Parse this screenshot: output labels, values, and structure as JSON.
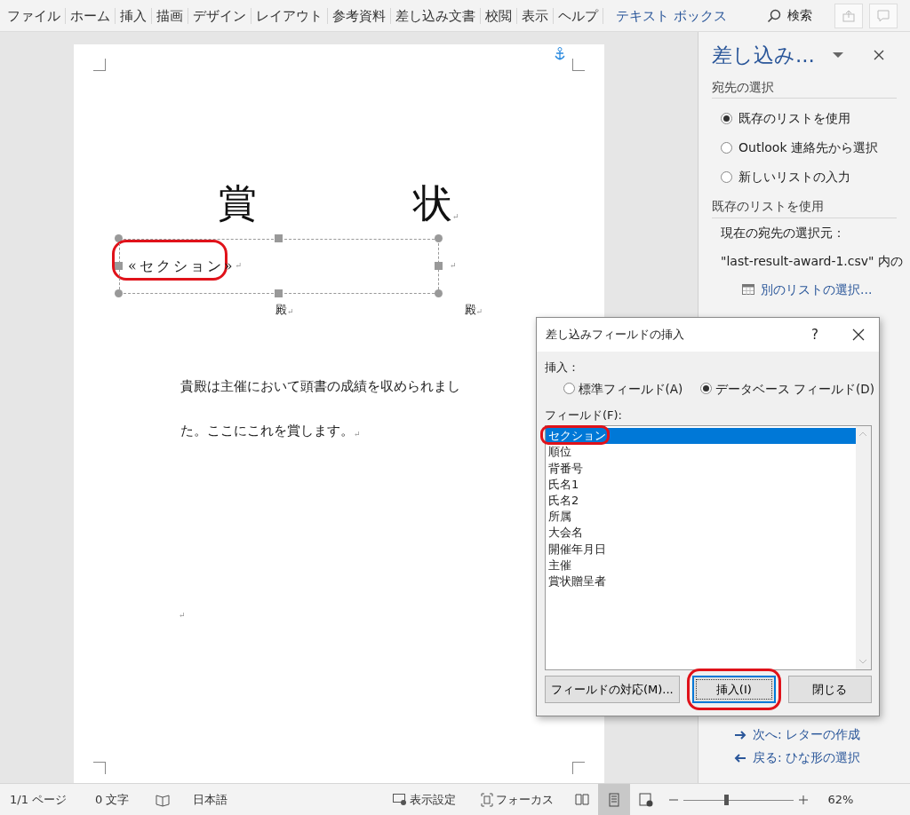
{
  "ribbon_tabs": [
    {
      "label": "ファイル",
      "contextual": false
    },
    {
      "label": "ホーム",
      "contextual": false
    },
    {
      "label": "挿入",
      "contextual": false
    },
    {
      "label": "描画",
      "contextual": false
    },
    {
      "label": "デザイン",
      "contextual": false
    },
    {
      "label": "レイアウト",
      "contextual": false
    },
    {
      "label": "参考資料",
      "contextual": false
    },
    {
      "label": "差し込み文書",
      "contextual": false
    },
    {
      "label": "校閲",
      "contextual": false
    },
    {
      "label": "表示",
      "contextual": false
    },
    {
      "label": "ヘルプ",
      "contextual": false
    },
    {
      "label": "テキスト ボックス",
      "contextual": true
    }
  ],
  "search": {
    "label": "検索"
  },
  "document": {
    "title_chars": [
      "賞",
      "状"
    ],
    "title_mark": "↵",
    "text_box": {
      "merge_field": "«セクション»",
      "mark": "↵",
      "highlighted": true,
      "outside_mark": "↵"
    },
    "honorifics": [
      {
        "text": "殿",
        "mark": "↵"
      },
      {
        "text": "殿",
        "mark": "↵"
      }
    ],
    "body_lines": [
      {
        "text": "貴殿は主催において頭書の成績を収められまし"
      },
      {
        "text": "た。ここにこれを賞します。",
        "mark": "↵"
      }
    ],
    "trailing_mark": "↵"
  },
  "task_pane": {
    "title": "差し込み...",
    "sections": [
      {
        "heading": "宛先の選択",
        "options": [
          {
            "label": "既存のリストを使用",
            "selected": true
          },
          {
            "label": "Outlook 連絡先から選択",
            "selected": false
          },
          {
            "label": "新しいリストの入力",
            "selected": false
          }
        ]
      },
      {
        "heading": "既存のリストを使用",
        "lines": [
          "現在の宛先の選択元：",
          "\"last-result-award-1.csv\" 内の"
        ],
        "link": "別のリストの選択..."
      }
    ],
    "nav": [
      {
        "kind": "next",
        "label": "次へ: レターの作成"
      },
      {
        "kind": "back",
        "label": "戻る: ひな形の選択"
      }
    ]
  },
  "dialog": {
    "title": "差し込みフィールドの挿入",
    "help": "?",
    "insert_label": "挿入：",
    "insert_options": [
      {
        "label": "標準フィールド(A)",
        "selected": false
      },
      {
        "label": "データベース フィールド(D)",
        "selected": true
      }
    ],
    "fields_label": "フィールド(F):",
    "fields": [
      {
        "label": "セクション",
        "selected": true,
        "highlighted": true
      },
      {
        "label": "順位",
        "selected": false,
        "highlighted": false
      },
      {
        "label": "背番号",
        "selected": false,
        "highlighted": false
      },
      {
        "label": "氏名1",
        "selected": false,
        "highlighted": false
      },
      {
        "label": "氏名2",
        "selected": false,
        "highlighted": false
      },
      {
        "label": "所属",
        "selected": false,
        "highlighted": false
      },
      {
        "label": "大会名",
        "selected": false,
        "highlighted": false
      },
      {
        "label": "開催年月日",
        "selected": false,
        "highlighted": false
      },
      {
        "label": "主催",
        "selected": false,
        "highlighted": false
      },
      {
        "label": "賞状贈呈者",
        "selected": false,
        "highlighted": false
      }
    ],
    "buttons": [
      {
        "label": "フィールドの対応(M)...",
        "default": false,
        "highlighted": false
      },
      {
        "label": "挿入(I)",
        "default": true,
        "highlighted": true
      },
      {
        "label": "閉じる",
        "default": false,
        "highlighted": false
      }
    ]
  },
  "status_bar": {
    "page": "1/1 ページ",
    "words": "0 文字",
    "language": "日本語",
    "display_settings": "表示設定",
    "focus": "フォーカス",
    "views": [
      {
        "kind": "read",
        "selected": false
      },
      {
        "kind": "print",
        "selected": true
      },
      {
        "kind": "web",
        "selected": false
      }
    ],
    "zoom": {
      "level": 0.38,
      "reading": "62%"
    }
  }
}
